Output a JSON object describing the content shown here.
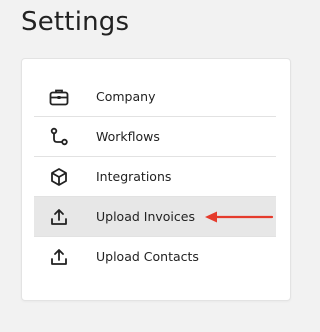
{
  "page": {
    "title": "Settings"
  },
  "menu": {
    "items": [
      {
        "label": "Company",
        "icon": "briefcase-icon",
        "active": false
      },
      {
        "label": "Workflows",
        "icon": "workflow-icon",
        "active": false
      },
      {
        "label": "Integrations",
        "icon": "cube-icon",
        "active": false
      },
      {
        "label": "Upload Invoices",
        "icon": "upload-icon",
        "active": true
      },
      {
        "label": "Upload Contacts",
        "icon": "upload-icon",
        "active": false
      }
    ]
  },
  "colors": {
    "background": "#f2f2f2",
    "card": "#ffffff",
    "active_row": "#e7e7e7",
    "annotation_arrow": "#e53b2c",
    "text": "#222222"
  }
}
